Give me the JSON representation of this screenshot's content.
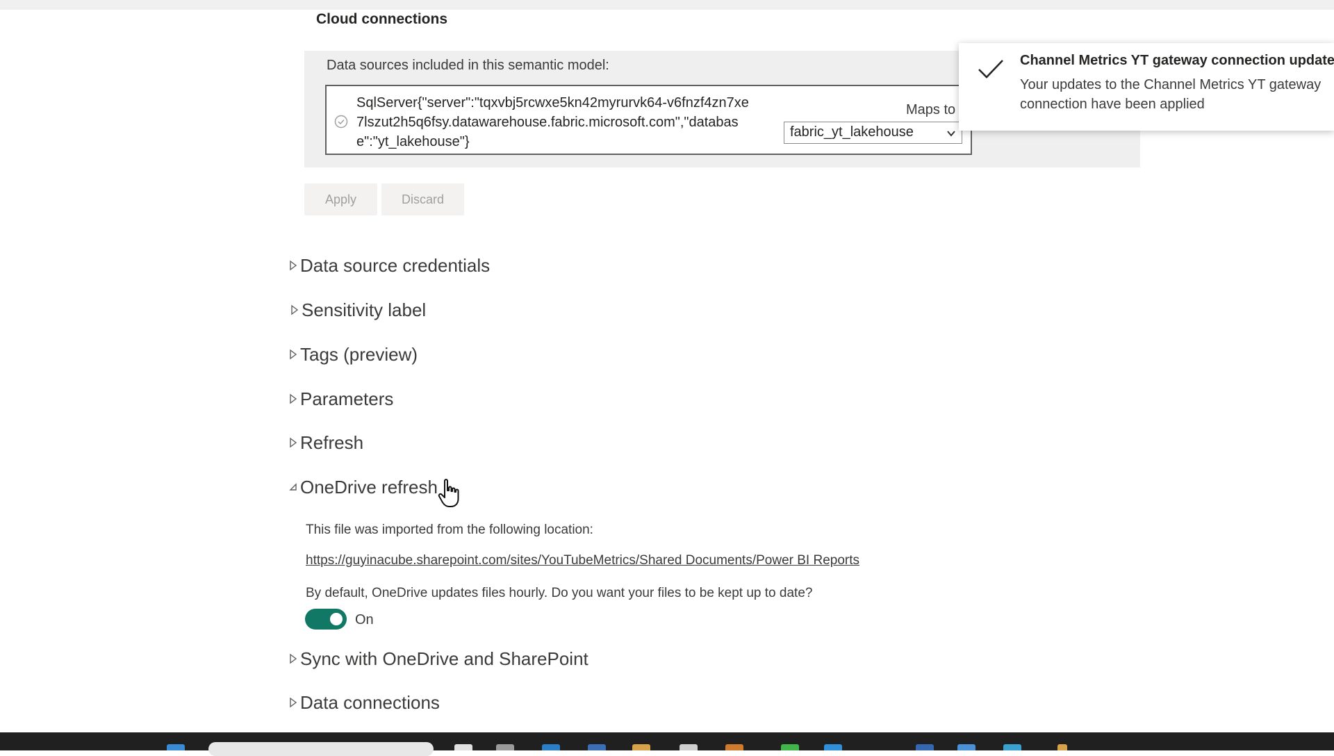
{
  "cloud_connections": {
    "title": "Cloud connections",
    "datasources_caption": "Data sources included in this semantic model:",
    "datasource_text": "SqlServer{\"server\":\"tqxvbj5rcwxe5kn42myrurvk64-v6fnzf4zn7xe7lszut2h5q6fsy.datawarehouse.fabric.microsoft.com\",\"database\":\"yt_lakehouse\"}",
    "maps_to_label": "Maps to",
    "maps_to_value": "fabric_yt_lakehouse",
    "apply_label": "Apply",
    "discard_label": "Discard"
  },
  "sections": [
    {
      "label": "Data source credentials",
      "expanded": false
    },
    {
      "label": "Sensitivity label",
      "expanded": false
    },
    {
      "label": "Tags (preview)",
      "expanded": false
    },
    {
      "label": "Parameters",
      "expanded": false
    },
    {
      "label": "Refresh",
      "expanded": false
    },
    {
      "label": "OneDrive refresh",
      "expanded": true
    },
    {
      "label": "Sync with OneDrive and SharePoint",
      "expanded": false
    },
    {
      "label": "Data connections",
      "expanded": false
    }
  ],
  "onedrive": {
    "imported_from_text": "This file was imported from the following location:",
    "location_url": "https://guyinacube.sharepoint.com/sites/YouTubeMetrics/Shared Documents/Power BI Reports",
    "default_text": "By default, OneDrive updates files hourly. Do you want your files to be kept up to date?",
    "toggle_label": "On",
    "toggle_on": true
  },
  "toast": {
    "title": "Channel Metrics YT gateway connection updated",
    "message": "Your updates to the Channel Metrics YT gateway connection have been applied"
  },
  "colors": {
    "toggle_on": "#117865",
    "panel_bg": "#efefef",
    "taskbar": "#202020"
  }
}
